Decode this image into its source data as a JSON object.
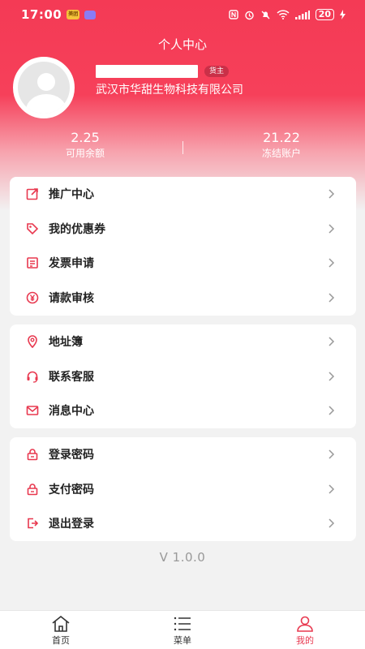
{
  "status_bar": {
    "time": "17:00",
    "app_badge": "美团",
    "battery": "20"
  },
  "header": {
    "title": "个人中心",
    "role_badge": "货主",
    "company": "武汉市华甜生物科技有限公司"
  },
  "balances": [
    {
      "value": "2.25",
      "label": "可用余额"
    },
    {
      "value": "21.22",
      "label": "冻结账户"
    }
  ],
  "menu_group_1": [
    {
      "label": "推广中心",
      "icon": "share-icon"
    },
    {
      "label": "我的优惠券",
      "icon": "coupon-tag-icon"
    },
    {
      "label": "发票申请",
      "icon": "invoice-icon"
    },
    {
      "label": "请款审核",
      "icon": "yen-icon"
    }
  ],
  "menu_group_2": [
    {
      "label": "地址簿",
      "icon": "location-pin-icon"
    },
    {
      "label": "联系客服",
      "icon": "headset-icon"
    },
    {
      "label": "消息中心",
      "icon": "mail-icon"
    }
  ],
  "menu_group_3": [
    {
      "label": "登录密码",
      "icon": "lock-icon"
    },
    {
      "label": "支付密码",
      "icon": "lock-icon"
    },
    {
      "label": "退出登录",
      "icon": "logout-icon"
    }
  ],
  "version": "V 1.0.0",
  "tabs": [
    {
      "label": "首页",
      "icon": "home-icon"
    },
    {
      "label": "菜单",
      "icon": "list-icon"
    },
    {
      "label": "我的",
      "icon": "user-icon"
    }
  ],
  "colors": {
    "accent": "#f43a55",
    "icon": "#e8384f",
    "background": "#f2f2f2"
  }
}
